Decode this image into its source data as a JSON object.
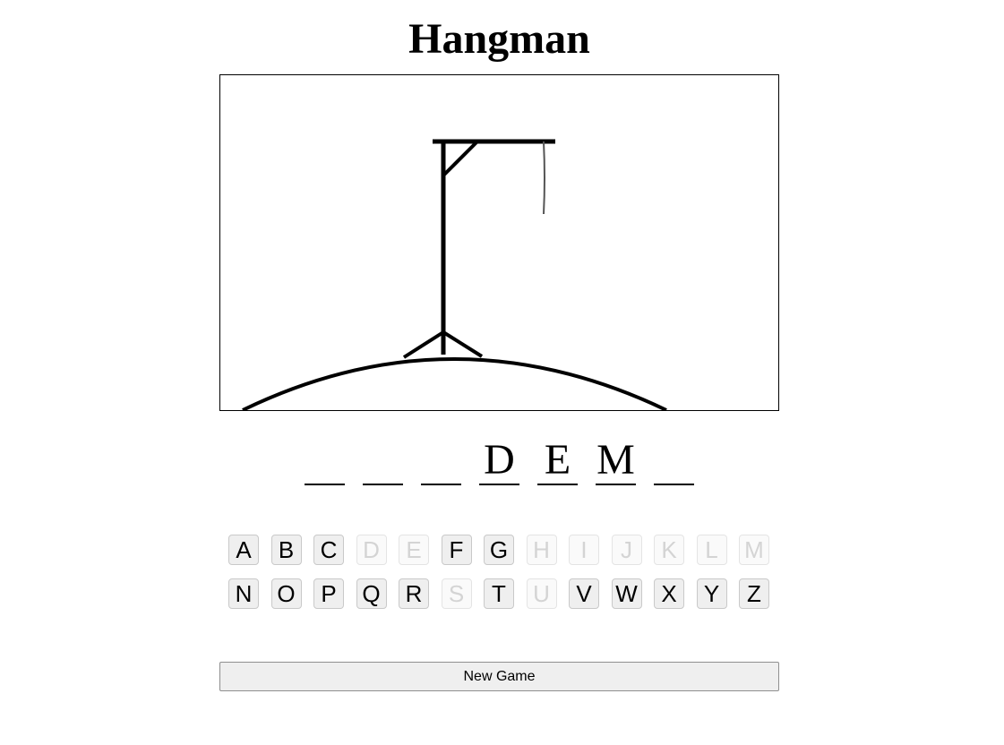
{
  "title": "Hangman",
  "gallows": {
    "parts_drawn": [
      "hill",
      "post",
      "beam",
      "brace",
      "rope"
    ],
    "stroke_color": "#000000",
    "rope_color": "#555555"
  },
  "word": {
    "letters": [
      "",
      "",
      "",
      "D",
      "E",
      "M",
      ""
    ]
  },
  "keyboard": {
    "rows": [
      [
        {
          "letter": "A",
          "used": false
        },
        {
          "letter": "B",
          "used": false
        },
        {
          "letter": "C",
          "used": false
        },
        {
          "letter": "D",
          "used": true
        },
        {
          "letter": "E",
          "used": true
        },
        {
          "letter": "F",
          "used": false
        },
        {
          "letter": "G",
          "used": false
        },
        {
          "letter": "H",
          "used": true
        },
        {
          "letter": "I",
          "used": true
        },
        {
          "letter": "J",
          "used": true
        },
        {
          "letter": "K",
          "used": true
        },
        {
          "letter": "L",
          "used": true
        },
        {
          "letter": "M",
          "used": true
        }
      ],
      [
        {
          "letter": "N",
          "used": false
        },
        {
          "letter": "O",
          "used": false
        },
        {
          "letter": "P",
          "used": false
        },
        {
          "letter": "Q",
          "used": false
        },
        {
          "letter": "R",
          "used": false
        },
        {
          "letter": "S",
          "used": true
        },
        {
          "letter": "T",
          "used": false
        },
        {
          "letter": "U",
          "used": true
        },
        {
          "letter": "V",
          "used": false
        },
        {
          "letter": "W",
          "used": false
        },
        {
          "letter": "X",
          "used": false
        },
        {
          "letter": "Y",
          "used": false
        },
        {
          "letter": "Z",
          "used": false
        }
      ]
    ]
  },
  "new_game_label": "New Game"
}
